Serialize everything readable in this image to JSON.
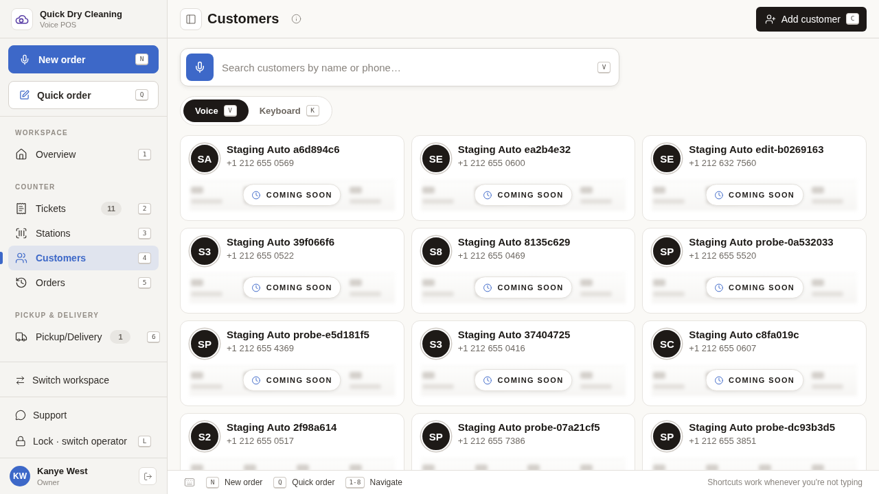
{
  "brand": {
    "name": "Quick Dry Cleaning",
    "subtitle": "Voice POS"
  },
  "actions": [
    {
      "kind": "primary",
      "label": "New order",
      "key": "N"
    },
    {
      "kind": "secondary",
      "label": "Quick order",
      "key": "Q"
    }
  ],
  "nav": [
    {
      "heading": "WORKSPACE",
      "items": [
        {
          "label": "Overview",
          "key": "1",
          "selected": false
        }
      ]
    },
    {
      "heading": "COUNTER",
      "items": [
        {
          "label": "Tickets",
          "count": "11",
          "key": "2",
          "selected": false
        },
        {
          "label": "Stations",
          "key": "3",
          "selected": false
        },
        {
          "label": "Customers",
          "key": "4",
          "selected": true
        },
        {
          "label": "Orders",
          "key": "5",
          "selected": false
        }
      ]
    },
    {
      "heading": "PICKUP & DELIVERY",
      "items": [
        {
          "label": "Pickup/Delivery",
          "count": "1",
          "key": "6",
          "selected": false
        }
      ]
    }
  ],
  "workspace_switch": {
    "label": "Switch workspace"
  },
  "footer_links": [
    {
      "label": "Support"
    },
    {
      "label": "Lock · switch operator",
      "key": "L"
    }
  ],
  "user": {
    "initials": "KW",
    "name": "Kanye West",
    "role": "Owner"
  },
  "header": {
    "title": "Customers",
    "add_button": {
      "label": "Add customer",
      "key": "C"
    }
  },
  "search": {
    "placeholder": "Search customers by name or phone…",
    "key": "V"
  },
  "mode_tabs": [
    {
      "label": "Voice",
      "key": "V",
      "selected": true
    },
    {
      "label": "Keyboard",
      "key": "K",
      "selected": false
    }
  ],
  "customers": [
    {
      "initials": "SA",
      "name": "Staging Auto a6d894c6",
      "phone": "+1 212 655 0569",
      "badge": "COMING SOON"
    },
    {
      "initials": "SE",
      "name": "Staging Auto ea2b4e32",
      "phone": "+1 212 655 0600",
      "badge": "COMING SOON"
    },
    {
      "initials": "SE",
      "name": "Staging Auto edit-b0269163",
      "phone": "+1 212 632 7560",
      "badge": "COMING SOON"
    },
    {
      "initials": "S3",
      "name": "Staging Auto 39f066f6",
      "phone": "+1 212 655 0522",
      "badge": "COMING SOON"
    },
    {
      "initials": "S8",
      "name": "Staging Auto 8135c629",
      "phone": "+1 212 655 0469",
      "badge": "COMING SOON"
    },
    {
      "initials": "SP",
      "name": "Staging Auto probe-0a532033",
      "phone": "+1 212 655 5520",
      "badge": "COMING SOON"
    },
    {
      "initials": "SP",
      "name": "Staging Auto probe-e5d181f5",
      "phone": "+1 212 655 4369",
      "badge": "COMING SOON"
    },
    {
      "initials": "S3",
      "name": "Staging Auto 37404725",
      "phone": "+1 212 655 0416",
      "badge": "COMING SOON"
    },
    {
      "initials": "SC",
      "name": "Staging Auto c8fa019c",
      "phone": "+1 212 655 0607",
      "badge": "COMING SOON"
    },
    {
      "initials": "S2",
      "name": "Staging Auto 2f98a614",
      "phone": "+1 212 655 0517"
    },
    {
      "initials": "SP",
      "name": "Staging Auto probe-07a21cf5",
      "phone": "+1 212 655 7386"
    },
    {
      "initials": "SP",
      "name": "Staging Auto probe-dc93b3d5",
      "phone": "+1 212 655 3851"
    }
  ],
  "shortcut_bar": {
    "items": [
      {
        "key": "N",
        "label": "New order"
      },
      {
        "key": "Q",
        "label": "Quick order"
      },
      {
        "key": "1-8",
        "label": "Navigate"
      }
    ],
    "hint": "Shortcuts work whenever you're not typing"
  }
}
